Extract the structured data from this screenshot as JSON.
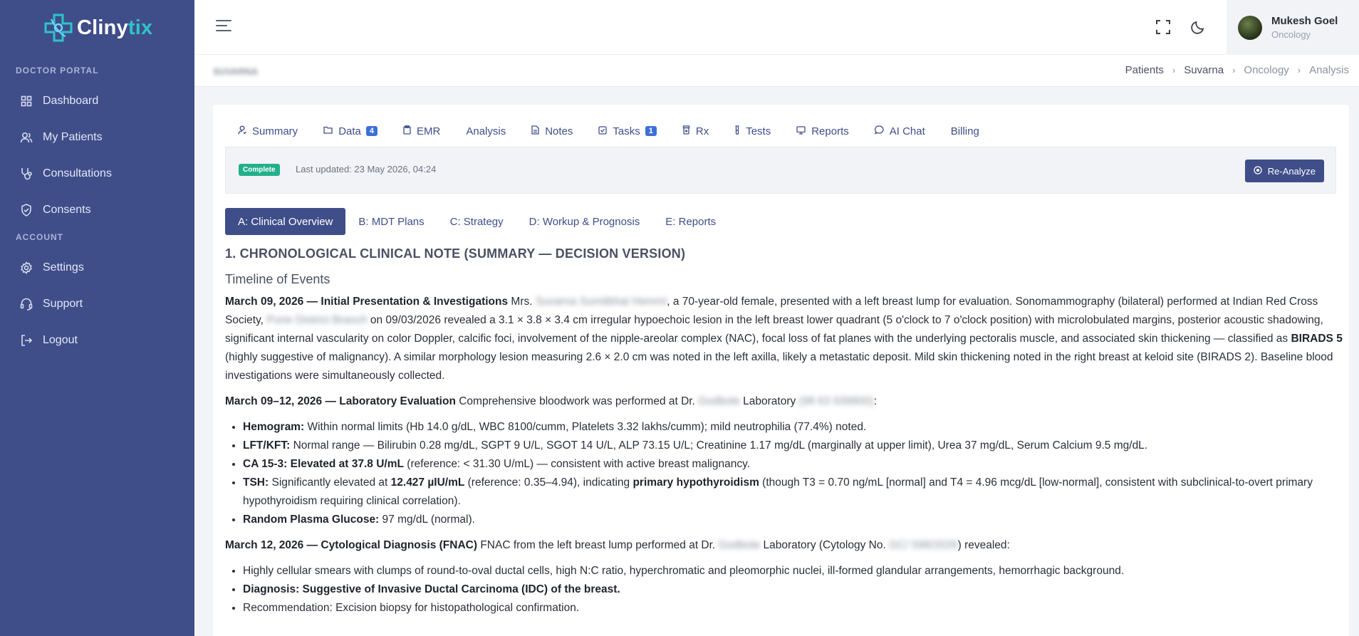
{
  "app": {
    "logo_main": "Clyni",
    "logo_accent": "tix",
    "logo_full": "Clinytix"
  },
  "sidebar": {
    "section_doctor": "DOCTOR PORTAL",
    "section_account": "ACCOUNT",
    "items": [
      {
        "label": "Dashboard",
        "icon": "grid-icon"
      },
      {
        "label": "My Patients",
        "icon": "users-icon"
      },
      {
        "label": "Consultations",
        "icon": "stethoscope-icon"
      },
      {
        "label": "Consents",
        "icon": "shield-check-icon"
      }
    ],
    "account_items": [
      {
        "label": "Settings",
        "icon": "gear-icon"
      },
      {
        "label": "Support",
        "icon": "headset-icon"
      },
      {
        "label": "Logout",
        "icon": "logout-icon"
      }
    ]
  },
  "header": {
    "user_name": "Mukesh Goel",
    "user_role": "Oncology"
  },
  "breadcrumb": {
    "page_title": "SUVARNA",
    "items": [
      "Patients",
      "Suvarna",
      "Oncology",
      "Analysis"
    ]
  },
  "tabs": [
    {
      "label": "Summary",
      "icon": "user-icon"
    },
    {
      "label": "Data",
      "icon": "folder-icon",
      "count": "4"
    },
    {
      "label": "EMR",
      "icon": "clipboard-icon"
    },
    {
      "label": "Analysis",
      "icon": "",
      "active": true
    },
    {
      "label": "Notes",
      "icon": "document-icon"
    },
    {
      "label": "Tasks",
      "icon": "checkbox-icon",
      "count": "1"
    },
    {
      "label": "Rx",
      "icon": "pill-bottle-icon"
    },
    {
      "label": "Tests",
      "icon": "test-tube-icon"
    },
    {
      "label": "Reports",
      "icon": "monitor-icon"
    },
    {
      "label": "AI Chat",
      "icon": "chat-icon"
    },
    {
      "label": "Billing",
      "icon": ""
    }
  ],
  "status": {
    "badge": "Complete",
    "last_updated": "Last updated: 23 May 2026, 04:24",
    "reanalyze_label": "Re-Analyze"
  },
  "subtabs": [
    {
      "label": "A: Clinical Overview",
      "active": true
    },
    {
      "label": "B: MDT Plans"
    },
    {
      "label": "C: Strategy"
    },
    {
      "label": "D: Workup & Prognosis"
    },
    {
      "label": "E: Reports"
    }
  ],
  "content": {
    "heading": "1. CHRONOLOGICAL CLINICAL NOTE (SUMMARY — DECISION VERSION)",
    "subheading": "Timeline of Events",
    "p1": {
      "date": "March 09, 2026 — Initial Presentation & Investigations",
      "t1": " Mrs. ",
      "redact1": "Suvarna Sumitbhai Hemmi",
      "t2": ", a 70-year-old female, presented with a left breast lump for evaluation. Sonomammography (bilateral) performed at Indian Red Cross Society, ",
      "redact2": "Pune District Branch",
      "t3": " on 09/03/2026 revealed a 3.1 × 3.8 × 3.4 cm irregular hypoechoic lesion in the left breast lower quadrant (5 o'clock to 7 o'clock position) with microlobulated margins, posterior acoustic shadowing, significant internal vascularity on color Doppler, calcific foci, involvement of the nipple-areolar complex (NAC), focal loss of fat planes with the underlying pectoralis muscle, and associated skin thickening — classified as ",
      "birads": "BIRADS 5",
      "t4": " (highly suggestive of malignancy). A similar morphology lesion measuring 2.6 × 2.0 cm was noted in the left axilla, likely a metastatic deposit. Mild skin thickening noted in the right breast at keloid site (BIRADS 2). Baseline blood investigations were simultaneously collected."
    },
    "p2": {
      "date": "March 09–12, 2026 — Laboratory Evaluation",
      "t1": " Comprehensive bloodwork was performed at Dr. ",
      "redact1": "Godbole",
      "t2": " Laboratory ",
      "redact2": "(98 63 939800)",
      "t3": ":"
    },
    "labs": [
      {
        "key": "Hemogram:",
        "text": " Within normal limits (Hb 14.0 g/dL, WBC 8100/cumm, Platelets 3.32 lakhs/cumm); mild neutrophilia (77.4%) noted."
      },
      {
        "key": "LFT/KFT:",
        "text": " Normal range — Bilirubin 0.28 mg/dL, SGPT 9 U/L, SGOT 14 U/L, ALP 73.15 U/L; Creatinine 1.17 mg/dL (marginally at upper limit), Urea 37 mg/dL, Serum Calcium 9.5 mg/dL."
      },
      {
        "key": "CA 15-3: Elevated at 37.8 U/mL",
        "text": " (reference: < 31.30 U/mL) — consistent with active breast malignancy."
      },
      {
        "key": "TSH:",
        "t1": " Significantly elevated at ",
        "b1": "12.427 µIU/mL",
        "t2": " (reference: 0.35–4.94), indicating ",
        "b2": "primary hypothyroidism",
        "t3": " (though T3 = 0.70 ng/mL [normal] and T4 = 4.96 mcg/dL [low-normal], consistent with subclinical-to-overt primary hypothyroidism requiring clinical correlation)."
      },
      {
        "key": "Random Plasma Glucose:",
        "text": " 97 mg/dL (normal)."
      }
    ],
    "p3": {
      "date": "March 12, 2026 — Cytological Diagnosis (FNAC)",
      "t1": " FNAC from the left breast lump performed at Dr. ",
      "redact1": "Godbole",
      "t2": " Laboratory (Cytology No. ",
      "redact2": "GC/ 598/2026",
      "t3": ") revealed:"
    },
    "cytology": [
      {
        "text": "Highly cellular smears with clumps of round-to-oval ductal cells, high N:C ratio, hyperchromatic and pleomorphic nuclei, ill-formed glandular arrangements, hemorrhagic background."
      },
      {
        "bold": "Diagnosis: Suggestive of Invasive Ductal Carcinoma (IDC) of the breast."
      },
      {
        "text": "Recommendation: Excision biopsy for histopathological confirmation."
      }
    ]
  }
}
